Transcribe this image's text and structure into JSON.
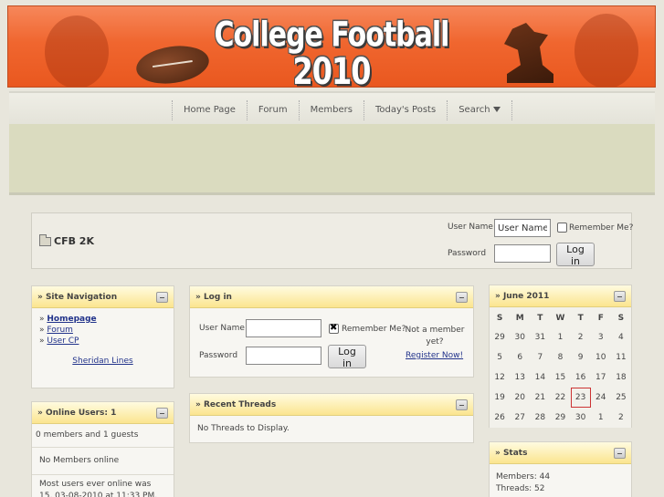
{
  "banner": {
    "line1": "College Football",
    "line2": "2010"
  },
  "nav": {
    "items": [
      {
        "label": "Home Page"
      },
      {
        "label": "Forum"
      },
      {
        "label": "Members"
      },
      {
        "label": "Today's Posts"
      },
      {
        "label": "Search"
      }
    ]
  },
  "breadcrumb": {
    "title": "CFB 2K",
    "username_label": "User Name",
    "username_value": "User Name",
    "remember_label": "Remember Me?",
    "password_label": "Password",
    "login_button": "Log in"
  },
  "site_nav": {
    "heading": "» Site Navigation",
    "links": [
      "Homepage",
      "Forum",
      "User CP"
    ],
    "extra_link": "Sheridan Lines"
  },
  "online_users": {
    "heading": "» Online Users: 1",
    "rows": [
      "0 members and 1 guests",
      "No Members online",
      "Most users ever online was 15, 03-08-2010 at 11:33 PM."
    ]
  },
  "login_panel": {
    "heading": "» Log in",
    "username_label": "User Name",
    "password_label": "Password",
    "remember_label": "Remember Me?",
    "login_button": "Log in",
    "not_member": "Not a member yet?",
    "register": "Register Now!"
  },
  "recent_threads": {
    "heading": "» Recent Threads",
    "empty": "No Threads to Display."
  },
  "calendar": {
    "heading": "» June 2011",
    "days_of_week": [
      "S",
      "M",
      "T",
      "W",
      "T",
      "F",
      "S"
    ],
    "weeks": [
      [
        "29",
        "30",
        "31",
        "1",
        "2",
        "3",
        "4"
      ],
      [
        "5",
        "6",
        "7",
        "8",
        "9",
        "10",
        "11"
      ],
      [
        "12",
        "13",
        "14",
        "15",
        "16",
        "17",
        "18"
      ],
      [
        "19",
        "20",
        "21",
        "22",
        "23",
        "24",
        "25"
      ],
      [
        "26",
        "27",
        "28",
        "29",
        "30",
        "1",
        "2"
      ]
    ],
    "today": "23"
  },
  "stats": {
    "heading": "» Stats",
    "rows": [
      "Members: 44",
      "Threads: 52"
    ]
  }
}
